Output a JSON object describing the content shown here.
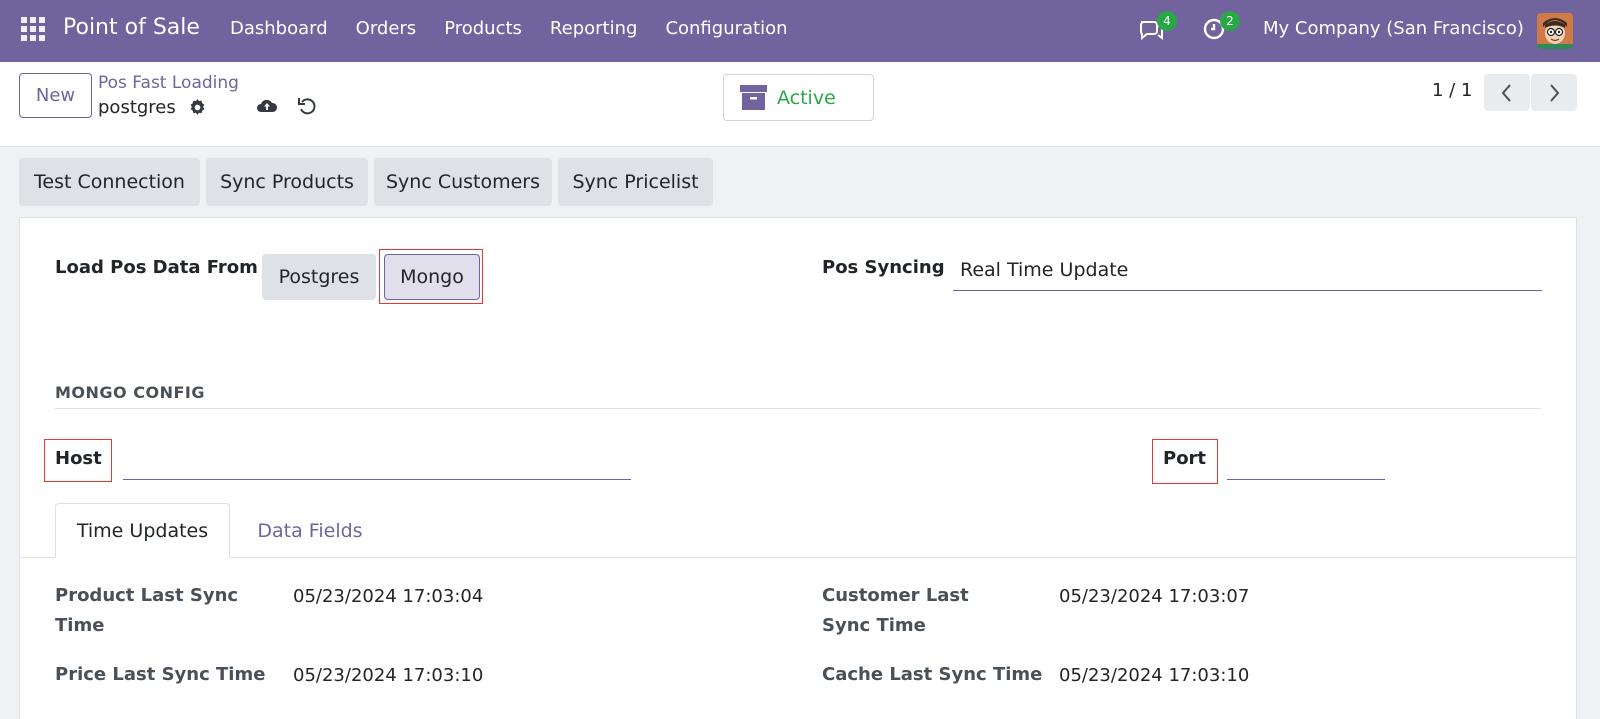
{
  "navbar": {
    "app_title": "Point of Sale",
    "menu": [
      "Dashboard",
      "Orders",
      "Products",
      "Reporting",
      "Configuration"
    ],
    "messages_count": "4",
    "activities_count": "2",
    "company": "My Company (San Francisco)"
  },
  "control_panel": {
    "new_label": "New",
    "breadcrumb_parent": "Pos Fast Loading",
    "breadcrumb_current": "postgres",
    "status_label": "Active",
    "pager": "1 / 1"
  },
  "actions": [
    "Test Connection",
    "Sync Products",
    "Sync Customers",
    "Sync Pricelist"
  ],
  "form": {
    "load_from_label": "Load Pos Data From",
    "load_options": [
      "Postgres",
      "Mongo"
    ],
    "load_selected": "Mongo",
    "pos_syncing_label": "Pos Syncing",
    "pos_syncing_value": "Real Time Update",
    "mongo_section_title": "MONGO CONFIG",
    "host_label": "Host",
    "host_value": "",
    "port_label": "Port",
    "port_value": ""
  },
  "tabs": [
    "Time Updates",
    "Data Fields"
  ],
  "active_tab": "Time Updates",
  "time_updates": {
    "product_label": "Product Last Sync Time",
    "product_value": "05/23/2024 17:03:04",
    "customer_label": "Customer Last Sync Time",
    "customer_value": "05/23/2024 17:03:07",
    "price_label": "Price Last Sync Time",
    "price_value": "05/23/2024 17:03:10",
    "cache_label": "Cache Last Sync Time",
    "cache_value": "05/23/2024 17:03:10"
  },
  "colors": {
    "brand": "#71639e",
    "active_green": "#28a745",
    "highlight_red": "#e53935"
  }
}
